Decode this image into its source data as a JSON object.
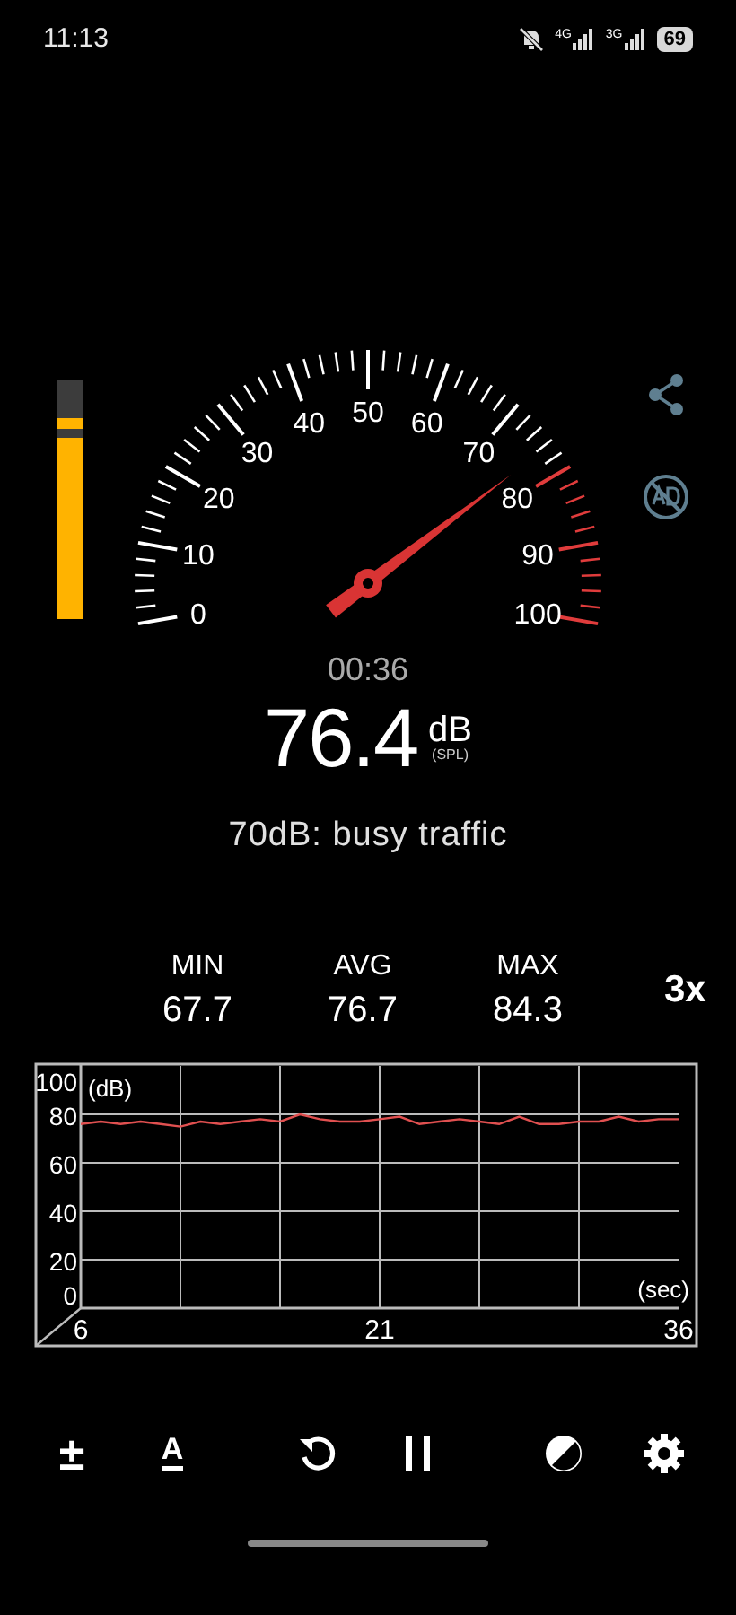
{
  "status_bar": {
    "time": "11:13",
    "network_1": "4G",
    "network_2": "3G",
    "battery": "69"
  },
  "level_meter": {
    "level": 0.76,
    "peak": {
      "level": 0.84
    }
  },
  "gauge": {
    "top_label": "50",
    "left_labels": [
      "40",
      "30",
      "20",
      "10",
      "0"
    ],
    "right_labels": [
      "60",
      "70",
      "80",
      "90",
      "100"
    ]
  },
  "reading": {
    "elapsed": "00:36",
    "value": "76.4",
    "unit": "dB",
    "weighting": "(SPL)",
    "description": "70dB: busy traffic"
  },
  "stats": [
    {
      "label": "MIN",
      "value": "67.7"
    },
    {
      "label": "AVG",
      "value": "76.7"
    },
    {
      "label": "MAX",
      "value": "84.3"
    }
  ],
  "zoom": "3x",
  "history": {
    "chart_data": {
      "type": "line",
      "xlabel": "(sec)",
      "ylabel": "(dB)",
      "x": [
        6,
        7,
        8,
        9,
        10,
        11,
        12,
        13,
        14,
        15,
        16,
        17,
        18,
        19,
        20,
        21,
        22,
        23,
        24,
        25,
        26,
        27,
        28,
        29,
        30,
        31,
        32,
        33,
        34,
        35,
        36
      ],
      "series": [
        {
          "color": "#e05050",
          "values": [
            76,
            77,
            76,
            77,
            76,
            75,
            77,
            76,
            77,
            78,
            77,
            80,
            78,
            77,
            77,
            78,
            79,
            76,
            77,
            78,
            77,
            76,
            79,
            76,
            76,
            77,
            77,
            79,
            77,
            78,
            78
          ]
        }
      ],
      "xlim": [
        6,
        36
      ],
      "ylim": [
        0,
        100
      ],
      "xticks": [
        6,
        21,
        36
      ],
      "yticks": [
        0,
        20,
        40,
        60,
        80,
        100
      ],
      "grid": true
    }
  },
  "toolbar": [
    {
      "kind": "text",
      "label": "±"
    },
    {
      "kind": "text",
      "label": "A"
    },
    {
      "kind": "reset"
    },
    {
      "kind": "pause"
    },
    {
      "kind": "contrast"
    },
    {
      "kind": "settings"
    }
  ]
}
